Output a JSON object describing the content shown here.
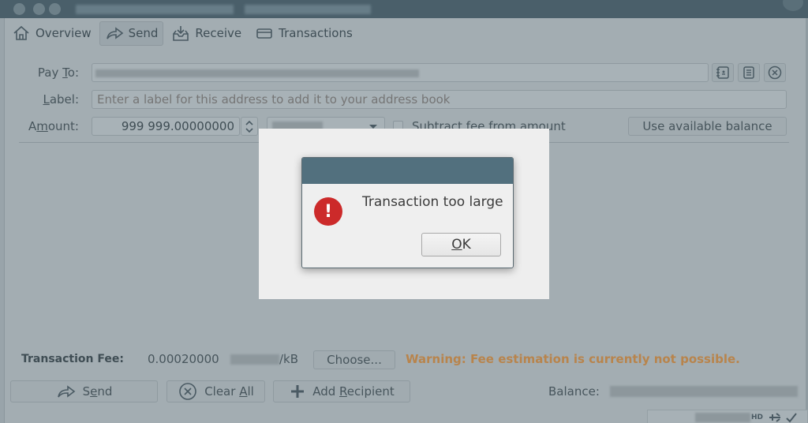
{
  "window": {
    "title_obscured": true
  },
  "toolbar": {
    "tabs": [
      {
        "label": "Overview",
        "icon": "home-icon",
        "active": false
      },
      {
        "label": "Send",
        "icon": "send-arrow-icon",
        "active": true
      },
      {
        "label": "Receive",
        "icon": "receive-inbox-icon",
        "active": false
      },
      {
        "label": "Transactions",
        "icon": "card-icon",
        "active": false
      }
    ]
  },
  "form": {
    "pay_to": {
      "label_prefix": "Pay ",
      "label_underlined": "T",
      "label_suffix": "o:",
      "value_obscured": true
    },
    "label": {
      "label_underlined": "L",
      "label_suffix": "abel:",
      "placeholder": "Enter a label for this address to add it to your address book"
    },
    "amount": {
      "label_prefix": "A",
      "label_underlined": "m",
      "label_suffix": "ount:",
      "value": "999 999.00000000",
      "unit_obscured": true
    },
    "subtract_fee": {
      "label": "Subtract fee from amount",
      "checked": false
    },
    "use_balance_label": "Use available balance",
    "icons": [
      "address-book-icon",
      "paste-icon",
      "clear-icon"
    ]
  },
  "fee": {
    "label": "Transaction Fee:",
    "value": "0.00020000",
    "unit_suffix": "/kB",
    "choose_label": "Choose...",
    "warning": "Warning: Fee estimation is currently not possible.",
    "warning_color": "#b8844c"
  },
  "actions": {
    "send": {
      "prefix": "S",
      "underlined": "e",
      "suffix": "nd"
    },
    "clear_all": {
      "prefix": "Clear ",
      "underlined": "A",
      "suffix": "ll"
    },
    "add_recipient": {
      "prefix": "Add ",
      "underlined": "R",
      "suffix": "ecipient"
    }
  },
  "balance": {
    "label": "Balance:",
    "value_obscured": true
  },
  "statusbar": {
    "hd_label": "HD"
  },
  "dialog": {
    "message": "Transaction too large",
    "ok_underlined": "O",
    "ok_suffix": "K",
    "icon": "error-icon",
    "icon_color": "#cc2a2a"
  }
}
